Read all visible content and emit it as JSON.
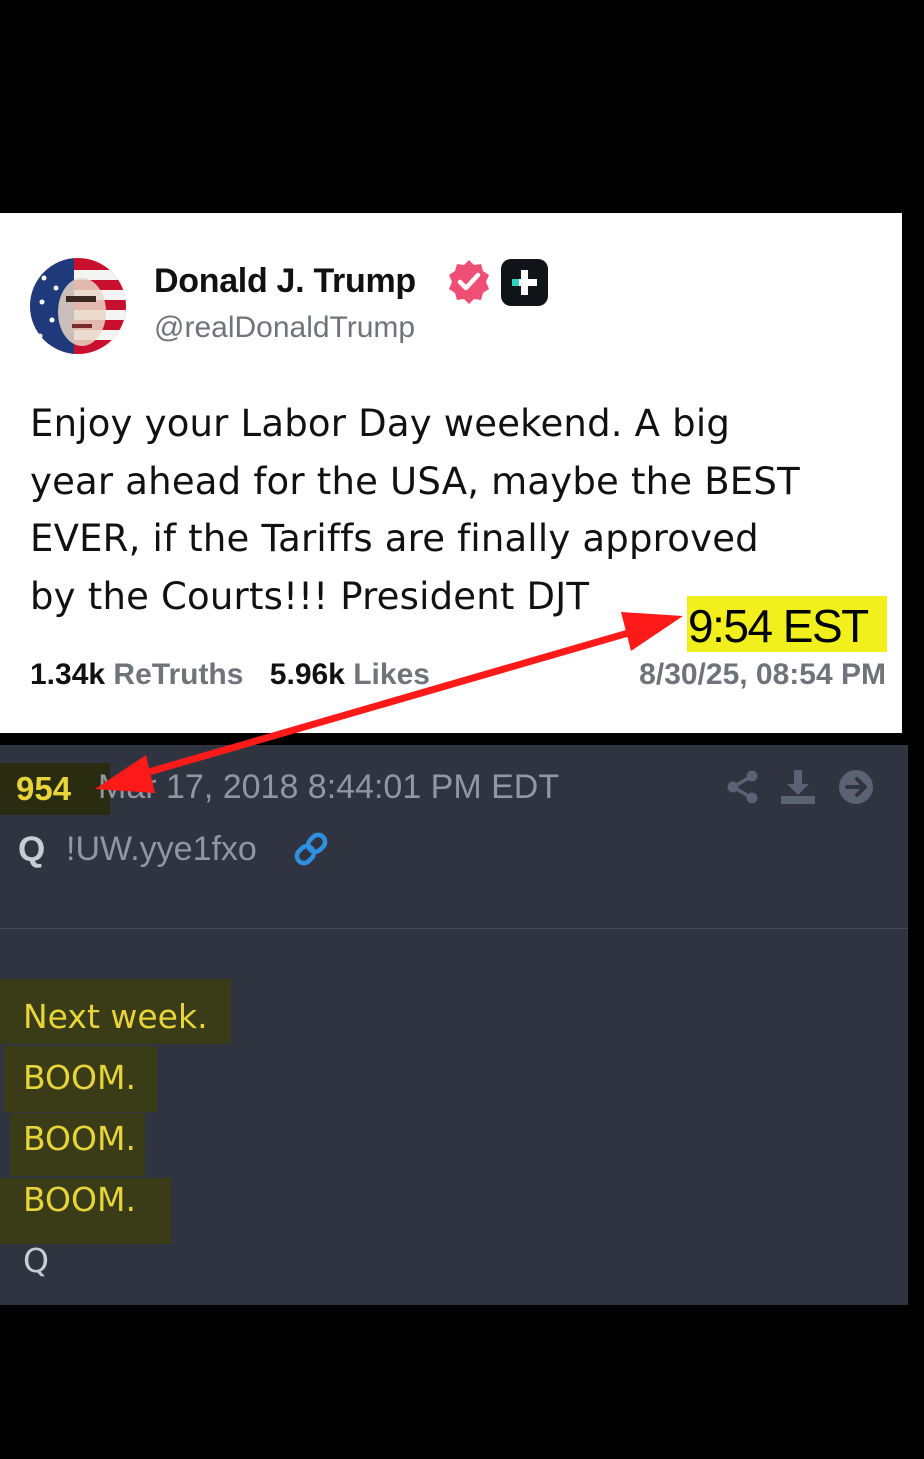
{
  "truth_post": {
    "display_name": "Donald J. Trump",
    "handle": "@realDonaldTrump",
    "lines": [
      "Enjoy your Labor Day weekend. A big",
      "year ahead for the USA, maybe the BEST",
      "EVER, if the Tariffs are finally approved",
      "by the Courts!!! President DJT"
    ],
    "retruths_count": "1.34k",
    "retruths_label": "ReTruths",
    "likes_count": "5.96k",
    "likes_label": "Likes",
    "date": "8/30/25, 08:54 PM"
  },
  "annotation": {
    "time_label": "9:54 EST",
    "highlight_color": "#f2f01c",
    "arrow_color": "#ff1a1a"
  },
  "q_post": {
    "number": "954",
    "timestamp": "Mar 17, 2018 8:44:01 PM EDT",
    "name": "Q",
    "tripcode": "!UW.yye1fxo",
    "icons": [
      "share-icon",
      "download-icon",
      "arrow-right-circle-icon",
      "link-icon"
    ],
    "lines": [
      "Next week.",
      "BOOM.",
      "BOOM.",
      "BOOM.",
      "Q"
    ]
  }
}
